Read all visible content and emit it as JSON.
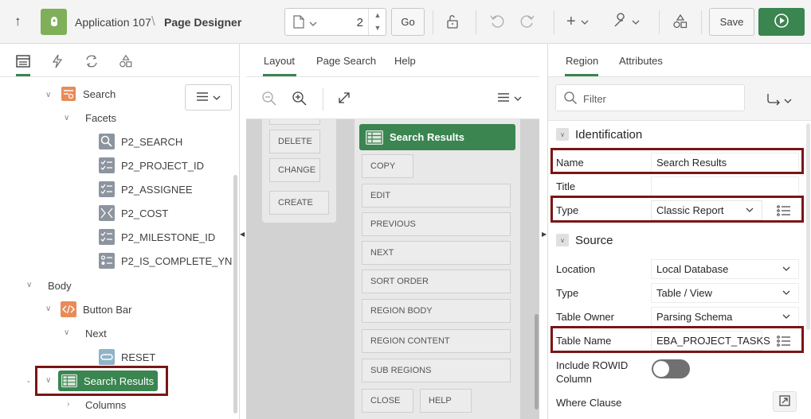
{
  "toolbar": {
    "app_name": "Application 107",
    "separator": "\\",
    "page_title": "Page Designer",
    "page_number": "2",
    "go_label": "Go",
    "save_label": "Save"
  },
  "left_panel": {
    "tree": {
      "search": "Search",
      "facets": "Facets",
      "p2_search": "P2_SEARCH",
      "p2_project_id": "P2_PROJECT_ID",
      "p2_assignee": "P2_ASSIGNEE",
      "p2_cost": "P2_COST",
      "p2_milestone_id": "P2_MILESTONE_ID",
      "p2_is_complete_yn": "P2_IS_COMPLETE_YN",
      "body": "Body",
      "button_bar": "Button Bar",
      "next": "Next",
      "reset": "RESET",
      "search_results": "Search Results",
      "columns": "Columns"
    }
  },
  "center_panel": {
    "tabs": {
      "layout": "Layout",
      "page_search": "Page Search",
      "help": "Help"
    },
    "left_card": {
      "delete": "DELETE",
      "change": "CHANGE",
      "create": "CREATE"
    },
    "region": {
      "title": "Search Results",
      "copy": "COPY",
      "edit": "EDIT",
      "previous": "PREVIOUS",
      "next": "NEXT",
      "sort_order": "SORT ORDER",
      "region_body": "REGION BODY",
      "region_content": "REGION CONTENT",
      "sub_regions": "SUB REGIONS",
      "close": "CLOSE",
      "help": "HELP"
    }
  },
  "right_panel": {
    "tabs": {
      "region": "Region",
      "attributes": "Attributes"
    },
    "filter_placeholder": "Filter",
    "identification": {
      "header": "Identification",
      "name_label": "Name",
      "name_value": "Search Results",
      "title_label": "Title",
      "title_value": "",
      "type_label": "Type",
      "type_value": "Classic Report"
    },
    "source": {
      "header": "Source",
      "location_label": "Location",
      "location_value": "Local Database",
      "type_label": "Type",
      "type_value": "Table / View",
      "table_owner_label": "Table Owner",
      "table_owner_value": "Parsing Schema",
      "table_name_label": "Table Name",
      "table_name_value": "EBA_PROJECT_TASKS",
      "include_rowid_label_1": "Include ROWID",
      "include_rowid_label_2": "Column",
      "where_clause_label": "Where Clause"
    }
  },
  "colors": {
    "accent": "#3a8550",
    "highlight": "#7a1616",
    "app_icon": "#7fb059"
  }
}
